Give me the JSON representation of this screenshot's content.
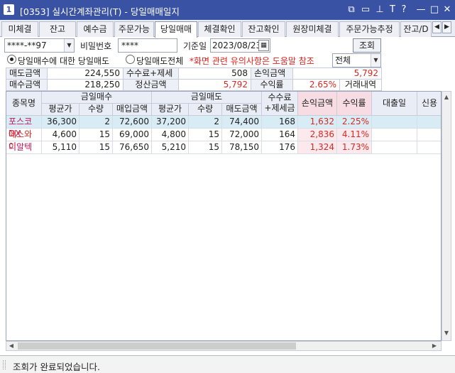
{
  "window": {
    "number": "1",
    "title": "[0353] 실시간계좌관리(T) - 당일매매일지",
    "controls": [
      "⧉",
      "▭",
      "⊥",
      "T",
      "?",
      "—",
      "□",
      "✕"
    ]
  },
  "tabs": [
    "미체결",
    "잔고",
    "예수금",
    "주문가능",
    "당일매매",
    "체결확인",
    "잔고확인",
    "원장미체결",
    "주문가능추정",
    "잔고/D"
  ],
  "active_tab": "당일매매",
  "tab_nav": [
    "◀",
    "▶"
  ],
  "form": {
    "account": "****-**97",
    "password_label": "비밀번호",
    "password": "****",
    "base_date_label": "기준일",
    "base_date": "2023/08/23",
    "search_button": "조회",
    "radio_sell_label": "당일매수에 대한 당일매도",
    "radio_all_label": "당일매도전체",
    "notice": "*화면 관련 유의사항은 도움말 참조",
    "filter_value": "전체",
    "history_label": "거래내역"
  },
  "summary": {
    "sell_amount_label": "매도금액",
    "sell_amount": "224,550",
    "fee_tax_label": "수수료+제세금",
    "fee_tax": "508",
    "pnl_label": "손익금액",
    "pnl": "5,792",
    "buy_amount_label": "매수금액",
    "buy_amount": "218,250",
    "settle_label": "정산금액",
    "settle": "5,792",
    "return_label": "수익률",
    "return": "2.65%"
  },
  "grid": {
    "group_buy": "금일매수",
    "group_sell": "금일매도",
    "col_name": "종목명",
    "col_buy_avg": "평균가",
    "col_buy_qty": "수량",
    "col_buy_amt": "매입금액",
    "col_sell_avg": "평균가",
    "col_sell_qty": "수량",
    "col_sell_amt": "매도금액",
    "col_fee_1": "수수료",
    "col_fee_2": "+제세금",
    "col_pnl": "손익금액",
    "col_return": "수익률",
    "col_loan_date": "대출일",
    "col_credit": "신용",
    "rows": [
      {
        "name": "포스코DX",
        "buy_avg": "36,300",
        "buy_qty": "2",
        "buy_amt": "72,600",
        "sell_avg": "37,200",
        "sell_qty": "2",
        "sell_amt": "74,400",
        "fee": "168",
        "pnl": "1,632",
        "ret": "2.25%"
      },
      {
        "name": "에스와이",
        "buy_avg": "4,600",
        "buy_qty": "15",
        "buy_amt": "69,000",
        "sell_avg": "4,800",
        "sell_qty": "15",
        "sell_amt": "72,000",
        "fee": "164",
        "pnl": "2,836",
        "ret": "4.11%"
      },
      {
        "name": "디알텍",
        "buy_avg": "5,110",
        "buy_qty": "15",
        "buy_amt": "76,650",
        "sell_avg": "5,210",
        "sell_qty": "15",
        "sell_amt": "78,150",
        "fee": "176",
        "pnl": "1,324",
        "ret": "1.73%"
      }
    ]
  },
  "status": {
    "message": "조회가 완료되었습니다."
  },
  "colors": {
    "title_bar": "#3a52a3",
    "profit_red": "#d62a20",
    "selected_row": "#d8ecf6",
    "pnl_column_bg": "#fbe9ee"
  }
}
